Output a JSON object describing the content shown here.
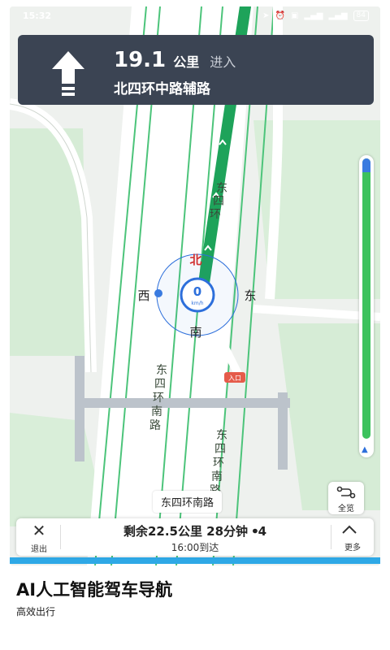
{
  "status_bar": {
    "time": "15:32",
    "battery": "84"
  },
  "colors": {
    "card_bg": "#3b4453",
    "route_green": "#1ea35a",
    "lane_green": "#4cc47a",
    "speed_blue": "#2d6fdb",
    "strip_blue": "#2ea8e6",
    "north_red": "#d23232"
  },
  "navigation": {
    "distance_value": "19.1",
    "distance_unit": "公里",
    "action": "进入",
    "road": "北四环中路辅路",
    "turn_icon": "straight-arrow-icon"
  },
  "map": {
    "road_labels": [
      "东",
      "四",
      "环",
      "东",
      "四",
      "环",
      "南",
      "路",
      "东",
      "四",
      "环",
      "南",
      "路"
    ],
    "compass": {
      "north": "北",
      "south": "南",
      "east": "东",
      "west": "西"
    },
    "speed": {
      "value": "0",
      "unit": "km/h"
    },
    "entrance_label": "入口",
    "current_road": "东四环南路"
  },
  "overview_button": {
    "label": "全览",
    "icon": "route-overview-icon"
  },
  "progress": {
    "traveled_fraction": 0.05
  },
  "bottom_bar": {
    "exit_label": "退出",
    "remaining": "剩余22.5公里 28分钟 ꔷ4",
    "arrival": "16:00到达",
    "more_label": "更多"
  },
  "promo": {
    "title": "AI人工智能驾车导航",
    "subtitle": "高效出行"
  }
}
